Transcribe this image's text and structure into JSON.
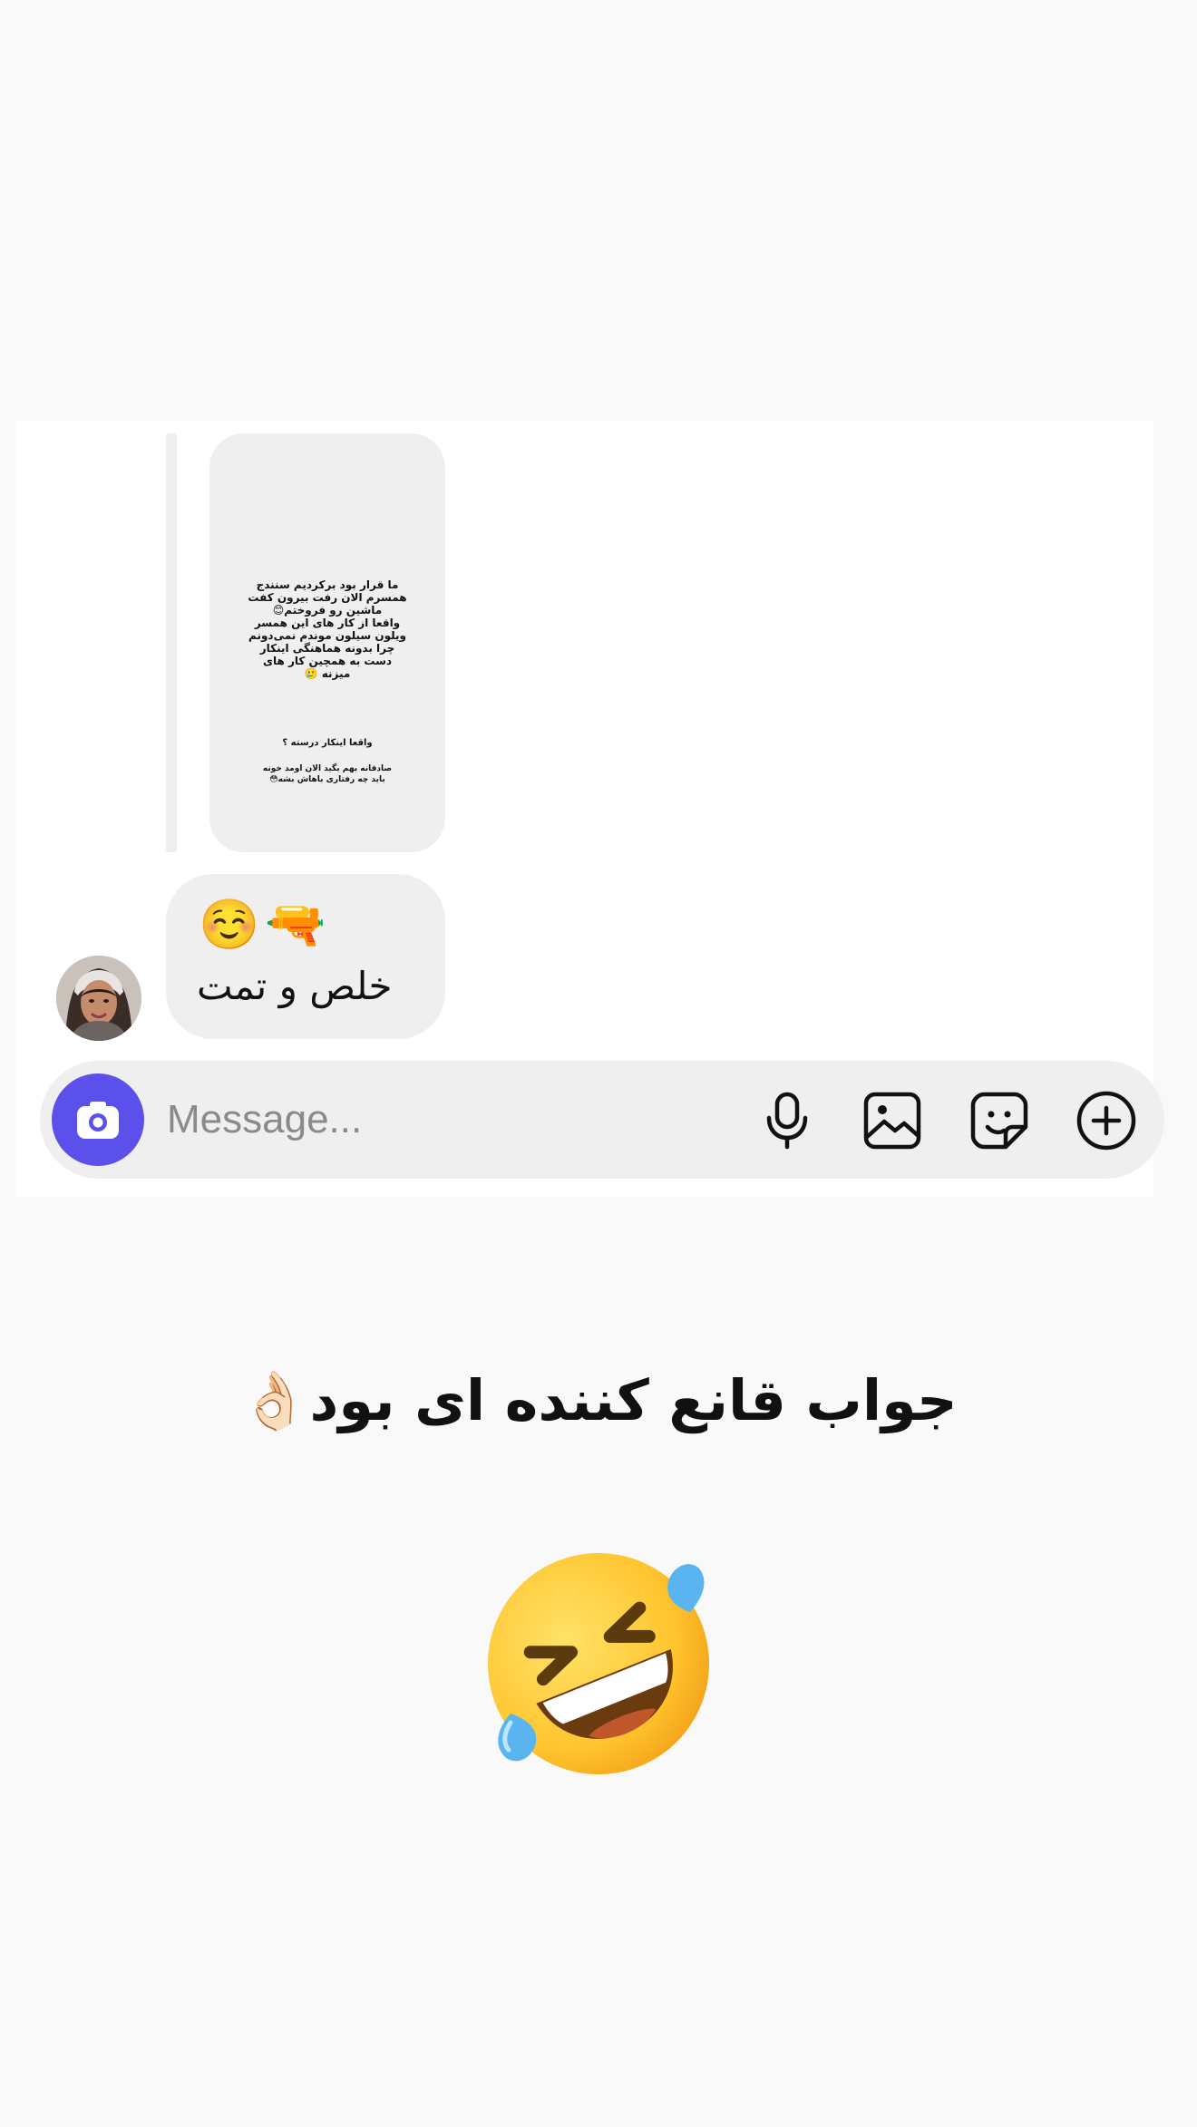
{
  "story_reply": {
    "text": "ما قرار بود برکردیم سنندج\nهمسرم الان رفت بیرون کفت\nماشین رو فروختم😊\nواقعا از کار های این همسر\nویلون سیلون موندم نمی‌دونم\nچرا بدونه هماهنگی اینکار\nدست به همچین کار های\nمیزنه 🥲",
    "question": "واقعا اینکار درسته ؟",
    "tail": "صادقانه بهم بگید الان اومد خونه\nباید چه رفتاری باهاش بشه😳"
  },
  "message": {
    "emojis": "☺️🔫",
    "text": "خلص و تمت"
  },
  "composer": {
    "placeholder": "Message...",
    "icons": [
      "camera-icon",
      "microphone-icon",
      "image-icon",
      "sticker-icon",
      "plus-icon"
    ]
  },
  "caption": "جواب قانع کننده ای بود👌🏻",
  "emoji_name": "rolling-on-floor-laughing",
  "colors": {
    "camera_button": "#5b51ea",
    "bubble": "#efefef",
    "background": "#f9f9f9"
  }
}
